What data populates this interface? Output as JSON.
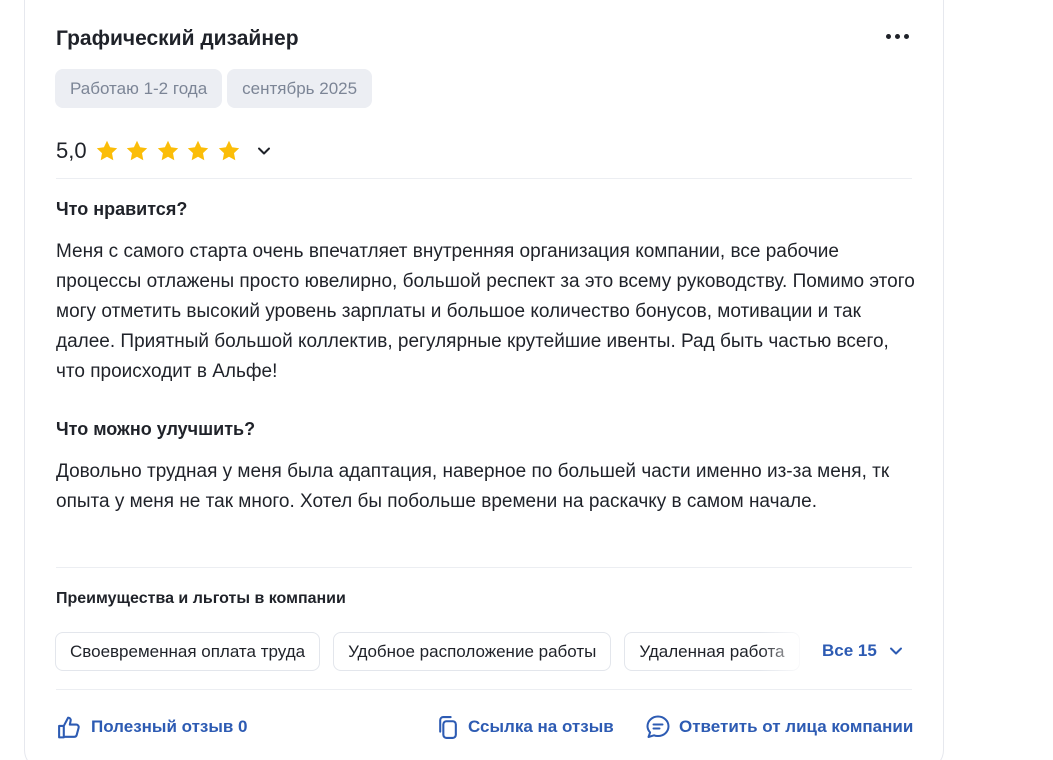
{
  "review": {
    "title": "Графический дизайнер",
    "tags": [
      "Работаю 1-2 года",
      "сентябрь 2025"
    ],
    "rating": {
      "value_label": "5,0",
      "stars": 5,
      "max_stars": 5
    },
    "likes": {
      "title": "Что нравится?",
      "text": "Меня с самого старта очень впечатляет внутренняя организация компании, все рабочие процессы отлажены просто ювелирно, большой респект за это всему руководству. Помимо этого могу отметить высокий уровень зарплаты и большое количество бонусов, мотивации и так далее. Приятный большой коллектив, регулярные крутейшие ивенты. Рад быть частью всего, что происходит в Альфе!"
    },
    "improve": {
      "title": "Что можно улучшить?",
      "text": "Довольно трудная у меня была адаптация, наверное по большей части именно из-за меня, тк опыта у меня не так много. Хотел бы побольше времени на раскачку в самом начале."
    },
    "benefits": {
      "title": "Преимущества и льготы в компании",
      "items": [
        "Своевременная оплата труда",
        "Удобное расположение работы",
        "Удаленная работа"
      ],
      "all_label": "Все 15"
    },
    "actions": {
      "helpful": "Полезный отзыв 0",
      "link": "Ссылка на отзыв",
      "reply": "Ответить от лица компании"
    }
  },
  "colors": {
    "accent": "#2d5bb3",
    "star": "#fbbd08",
    "chip_bg": "#eceef3"
  },
  "icons": [
    "more-icon",
    "star-icon",
    "chevron-down-icon",
    "thumbs-up-icon",
    "copy-link-icon",
    "chat-icon"
  ]
}
